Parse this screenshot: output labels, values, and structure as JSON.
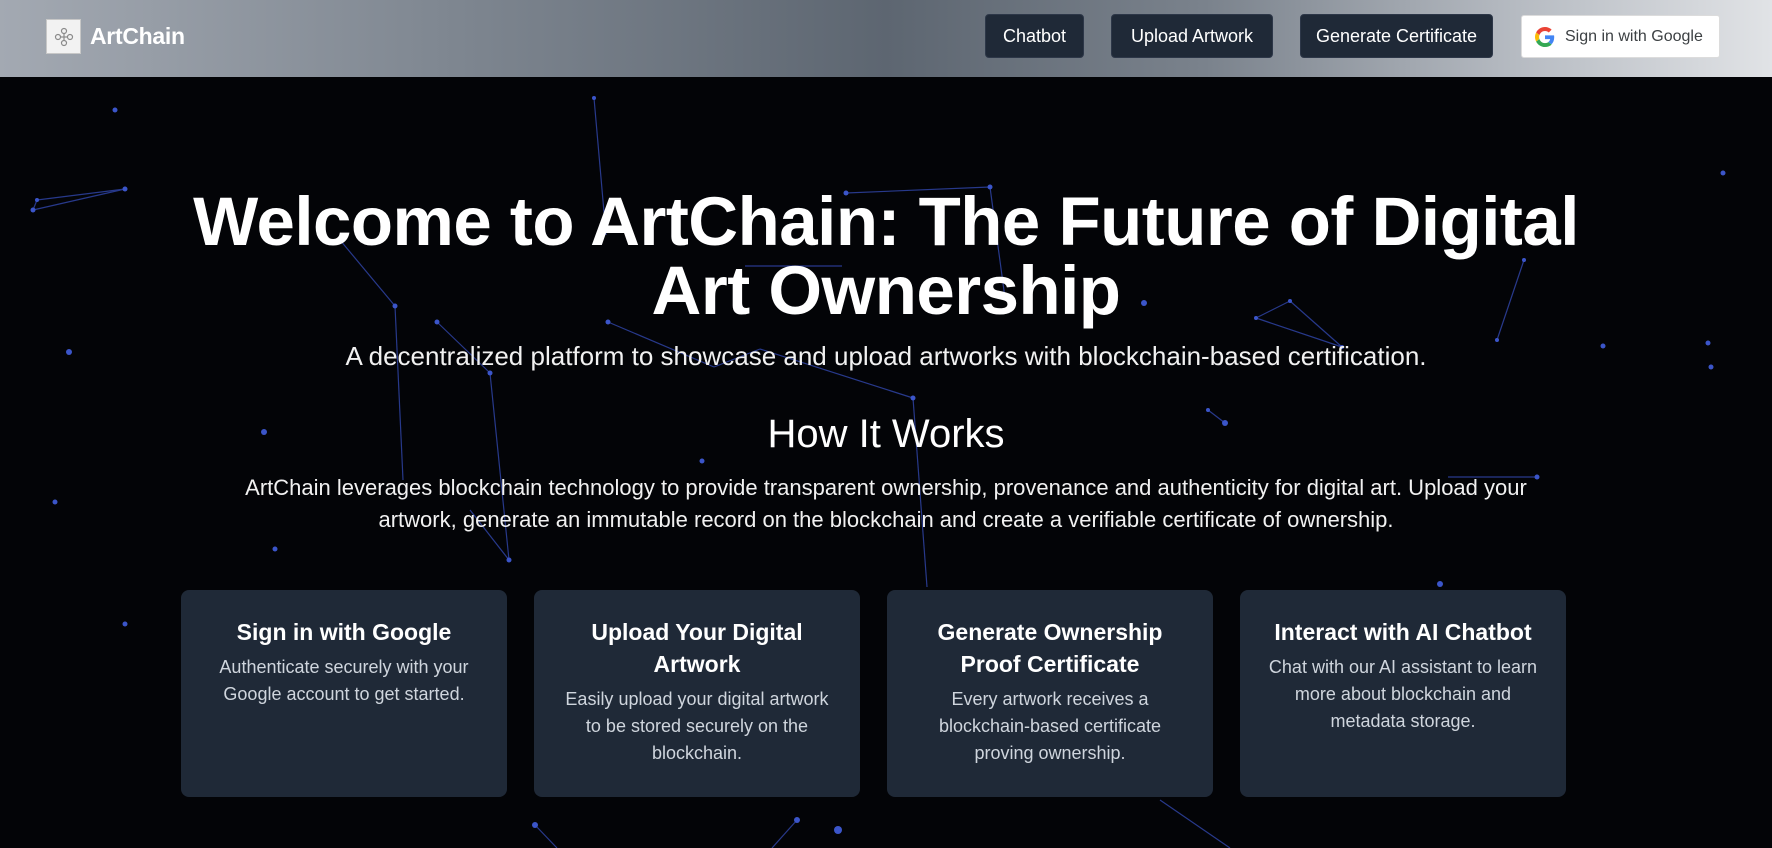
{
  "app": {
    "brand_name": "ArtChain"
  },
  "nav": {
    "chatbot_label": "Chatbot",
    "upload_label": "Upload Artwork",
    "generate_label": "Generate Certificate",
    "google_signin_label": "Sign in with Google"
  },
  "hero": {
    "title": "Welcome to ArtChain: The Future of Digital Art Ownership",
    "subtitle": "A decentralized platform to showcase and upload artworks with blockchain-based certification."
  },
  "how_it_works": {
    "title": "How It Works",
    "text": "ArtChain leverages blockchain technology to provide transparent ownership, provenance and authenticity for digital art. Upload your artwork, generate an immutable record on the blockchain and create a verifiable certificate of ownership."
  },
  "features": [
    {
      "title": "Sign in with Google",
      "description": "Authenticate securely with your Google account to get started."
    },
    {
      "title": "Upload Your Digital Artwork",
      "description": "Easily upload your digital artwork to be stored securely on the blockchain."
    },
    {
      "title": "Generate Ownership Proof Certificate",
      "description": "Every artwork receives a blockchain-based certificate proving ownership."
    },
    {
      "title": "Interact with AI Chatbot",
      "description": "Chat with our AI assistant to learn more about blockchain and metadata storage."
    }
  ],
  "colors": {
    "background": "#030407",
    "card": "#1f2937",
    "nav_button": "#1f2937",
    "network_node": "#3b55c9",
    "network_line": "#2c3f9a"
  },
  "icons": {
    "logo": "artchain-logo-icon",
    "google": "google-g-icon"
  }
}
